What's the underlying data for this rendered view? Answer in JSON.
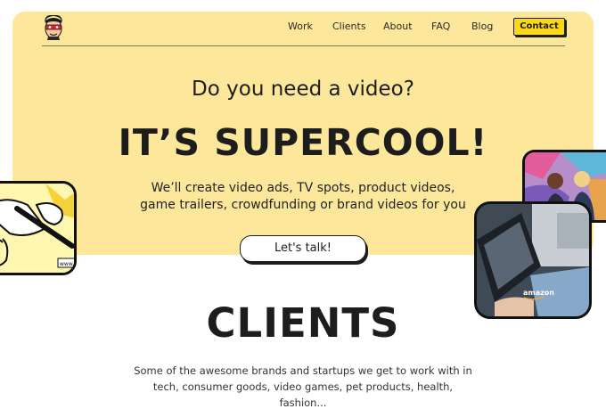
{
  "nav": {
    "links": [
      "Work",
      "Clients",
      "About",
      "FAQ",
      "Blog"
    ],
    "contact": "Contact"
  },
  "hero": {
    "question": "Do you need a video?",
    "headline": "IT’S SUPERCOOL!",
    "subtitle_line1": "We’ll create video ads, TV spots, product videos,",
    "subtitle_line2": "game trailers, crowdfunding or brand videos for you",
    "cta": "Let's talk!"
  },
  "cards": {
    "left_caption": "www.",
    "front_caption": "amazon"
  },
  "clients": {
    "title": "CLIENTS",
    "desc_line1": "Some of the awesome brands and startups we get to work with in",
    "desc_line2": "tech, consumer goods, video games, pet products, health,",
    "desc_line3": "fashion..."
  },
  "colors": {
    "hero_bg": "#fde79a",
    "accent": "#ffd814",
    "ink": "#1d1d1d"
  }
}
